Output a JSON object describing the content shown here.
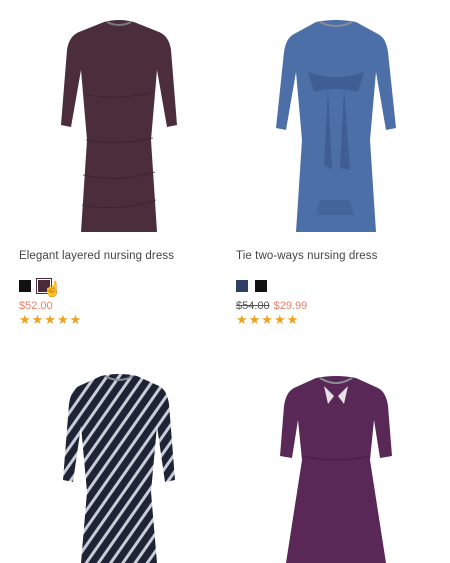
{
  "products": [
    {
      "name": "Elegant layered nursing dress",
      "swatches": [
        {
          "color": "#111111",
          "selected": false
        },
        {
          "color": "#4a2a36",
          "selected": true
        }
      ],
      "price": "$52.00",
      "old_price": "",
      "rating": 5,
      "dress_color": "#4b2d3c",
      "dress_icon": "dress-image"
    },
    {
      "name": "Tie two-ways nursing dress",
      "swatches": [
        {
          "color": "#2e3f66",
          "selected": false
        },
        {
          "color": "#111111",
          "selected": false
        }
      ],
      "price": "$29.99",
      "old_price": "$54.00",
      "rating": 5,
      "dress_color": "#4d6fa8",
      "dress_icon": "dress-image"
    },
    {
      "name": "",
      "dress_color": "#1e2436",
      "stripe_color": "#c9ccd6",
      "dress_icon": "dress-image"
    },
    {
      "name": "",
      "dress_color": "#5a2856",
      "dress_icon": "dress-image"
    }
  ],
  "colors": {
    "star": "#f0a21d",
    "sale_price": "#e0846c"
  },
  "stars_glyph": "★★★★★",
  "cursor_icon": "hand-pointer-icon"
}
